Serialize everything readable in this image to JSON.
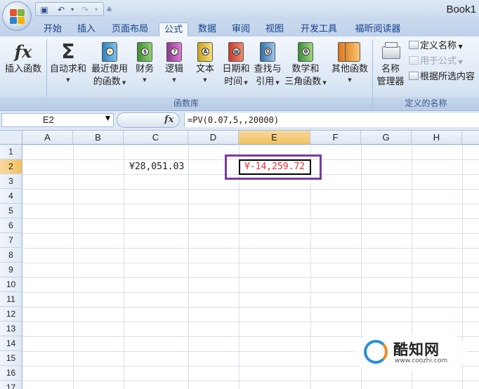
{
  "window": {
    "title": "Book1"
  },
  "tabs": [
    "开始",
    "插入",
    "页面布局",
    "公式",
    "数据",
    "审阅",
    "视图",
    "开发工具",
    "福昕阅读器"
  ],
  "active_tab": "公式",
  "ribbon": {
    "insert_function": "插入函数",
    "autosum": {
      "line1": "自动求和",
      "arrow": "▾"
    },
    "recent": {
      "line1": "最近使用",
      "line2": "的函数"
    },
    "financial": {
      "line1": "财务"
    },
    "logical": {
      "line1": "逻辑"
    },
    "text": {
      "line1": "文本"
    },
    "datetime": {
      "line1": "日期和",
      "line2": "时间"
    },
    "lookup": {
      "line1": "查找与",
      "line2": "引用"
    },
    "math": {
      "line1": "数学和",
      "line2": "三角函数"
    },
    "more": {
      "line1": "其他函数"
    },
    "name_manager": {
      "line1": "名称",
      "line2": "管理器"
    },
    "define_name": "定义名称",
    "use_in_formula": "用于公式",
    "create_from_selection": "根据所选内容",
    "group_function_library": "函数库",
    "group_defined_names": "定义的名称",
    "book_letters": {
      "financial": "$",
      "logical": "?",
      "text": "A",
      "math": "θ",
      "lookup": "Q",
      "datetime": "▦",
      "recent": "★"
    }
  },
  "formula_bar": {
    "name_box": "E2",
    "fx": "fx",
    "formula": "=PV(0.07,5,,20000)"
  },
  "columns": [
    "A",
    "B",
    "C",
    "D",
    "E",
    "F",
    "G",
    "H"
  ],
  "rows": [
    "1",
    "2",
    "3",
    "4",
    "5",
    "6",
    "7",
    "8",
    "9",
    "10",
    "11",
    "12",
    "13",
    "14",
    "15",
    "16",
    "17"
  ],
  "cells": {
    "C2": "¥28,051.03",
    "E2": "¥-14,259.72"
  },
  "colors": {
    "negative_value": "#e03030",
    "highlight_box": "#7a3c9c"
  },
  "watermark": {
    "name": "酷知网",
    "url": "www.coozhi.com"
  }
}
